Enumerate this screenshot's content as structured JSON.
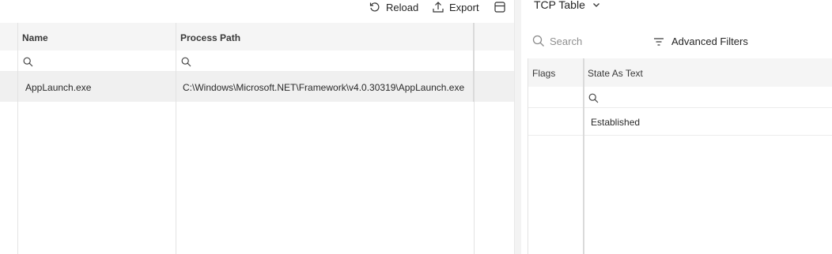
{
  "toolbar": {
    "reload_label": "Reload",
    "export_label": "Export",
    "layout_icon": "layout-icon"
  },
  "left_table": {
    "columns": [
      {
        "label": "Name"
      },
      {
        "label": "Process Path"
      }
    ],
    "rows": [
      {
        "name": "AppLaunch.exe",
        "process_path": "C:\\Windows\\Microsoft.NET\\Framework\\v4.0.30319\\AppLaunch.exe"
      }
    ]
  },
  "right_pane": {
    "title": "TCP Table",
    "search": {
      "placeholder": "Search",
      "value": ""
    },
    "advanced_filters_label": "Advanced Filters",
    "columns": [
      {
        "label": "Flags"
      },
      {
        "label": "State As Text"
      }
    ],
    "rows": [
      {
        "flags": "",
        "state": "Established"
      }
    ]
  }
}
